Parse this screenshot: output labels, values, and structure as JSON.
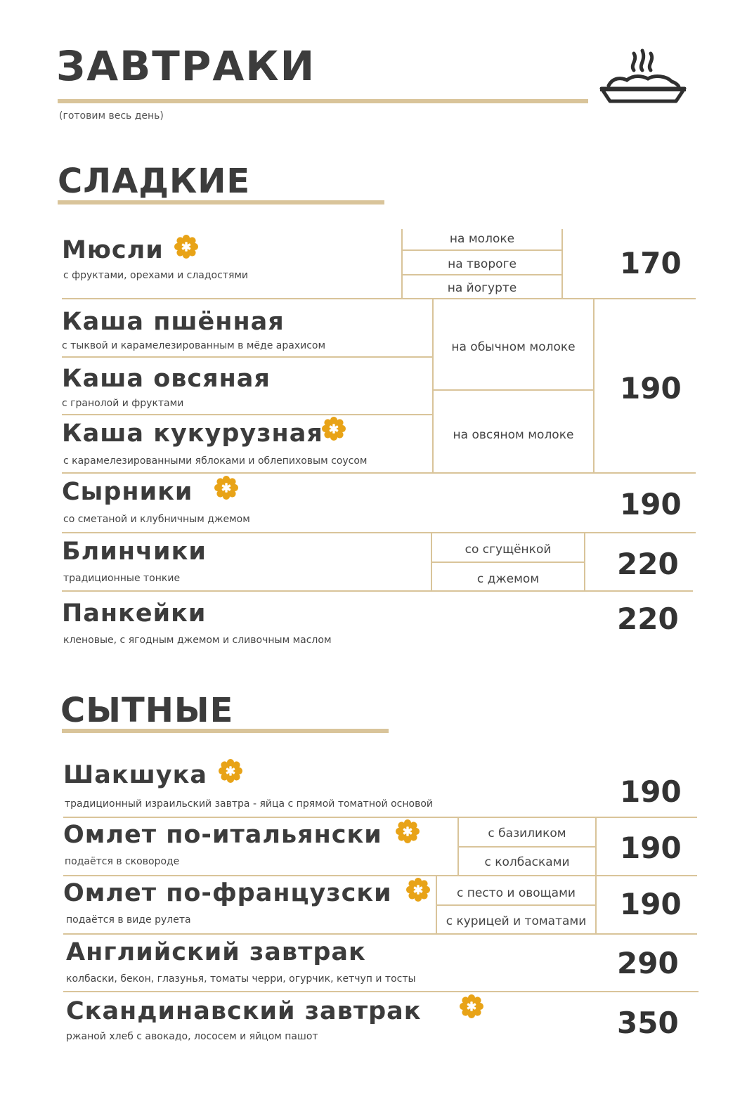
{
  "header": {
    "title": "ЗАВТРАКИ",
    "note": "(готовим весь день)",
    "icon": "bowl-steam-icon"
  },
  "colors": {
    "accent_line": "#d9c49a",
    "flag": "#e8a317",
    "text": "#3c3c3c"
  },
  "sections": {
    "sweet": {
      "title": "СЛАДКИЕ",
      "items": [
        {
          "name": "Мюсли",
          "desc": "с фруктами, орехами и сладостями",
          "options": [
            "на молоке",
            "на твороге",
            "на йогурте"
          ],
          "price": "170",
          "flag": true
        },
        {
          "name": "Каша пшённая",
          "desc": "с тыквой и карамелезированным в мёде арахисом"
        },
        {
          "name": "Каша овсяная",
          "desc": "с гранолой и фруктами"
        },
        {
          "name": "Каша кукурузная",
          "desc": "с карамелезированными яблоками и облепиховым соусом",
          "flag": true
        },
        {
          "name": "Сырники",
          "desc": "со сметаной и клубничным джемом",
          "price": "190",
          "flag": true
        },
        {
          "name": "Блинчики",
          "desc": "традиционные тонкие",
          "options": [
            "со сгущёнкой",
            "с джемом"
          ],
          "price": "220"
        },
        {
          "name": "Панкейки",
          "desc": "кленовые, с ягодным джемом и сливочным маслом",
          "price": "220"
        }
      ],
      "porridge_options": [
        "на обычном молоке",
        "на овсяном молоке"
      ],
      "porridge_price": "190"
    },
    "hearty": {
      "title": "СЫТНЫЕ",
      "items": [
        {
          "name": "Шакшука",
          "desc": "традиционный израильский завтра - яйца с прямой томатной основой",
          "price": "190",
          "flag": true
        },
        {
          "name": "Омлет по-итальянски",
          "desc": "подаётся в сковороде",
          "options": [
            "с базиликом",
            "с колбасками"
          ],
          "price": "190",
          "flag": true
        },
        {
          "name": "Омлет по-французски",
          "desc": "подаётся в виде рулета",
          "options": [
            "с песто и овощами",
            "с курицей и томатами"
          ],
          "price": "190",
          "flag": true
        },
        {
          "name": "Английский завтрак",
          "desc": "колбаски, бекон, глазунья, томаты черри, огурчик, кетчуп и тосты",
          "price": "290"
        },
        {
          "name": "Скандинавский завтрак",
          "desc": "ржаной хлеб с авокадо, лососем и яйцом пашот",
          "price": "350",
          "flag": true
        }
      ]
    }
  }
}
